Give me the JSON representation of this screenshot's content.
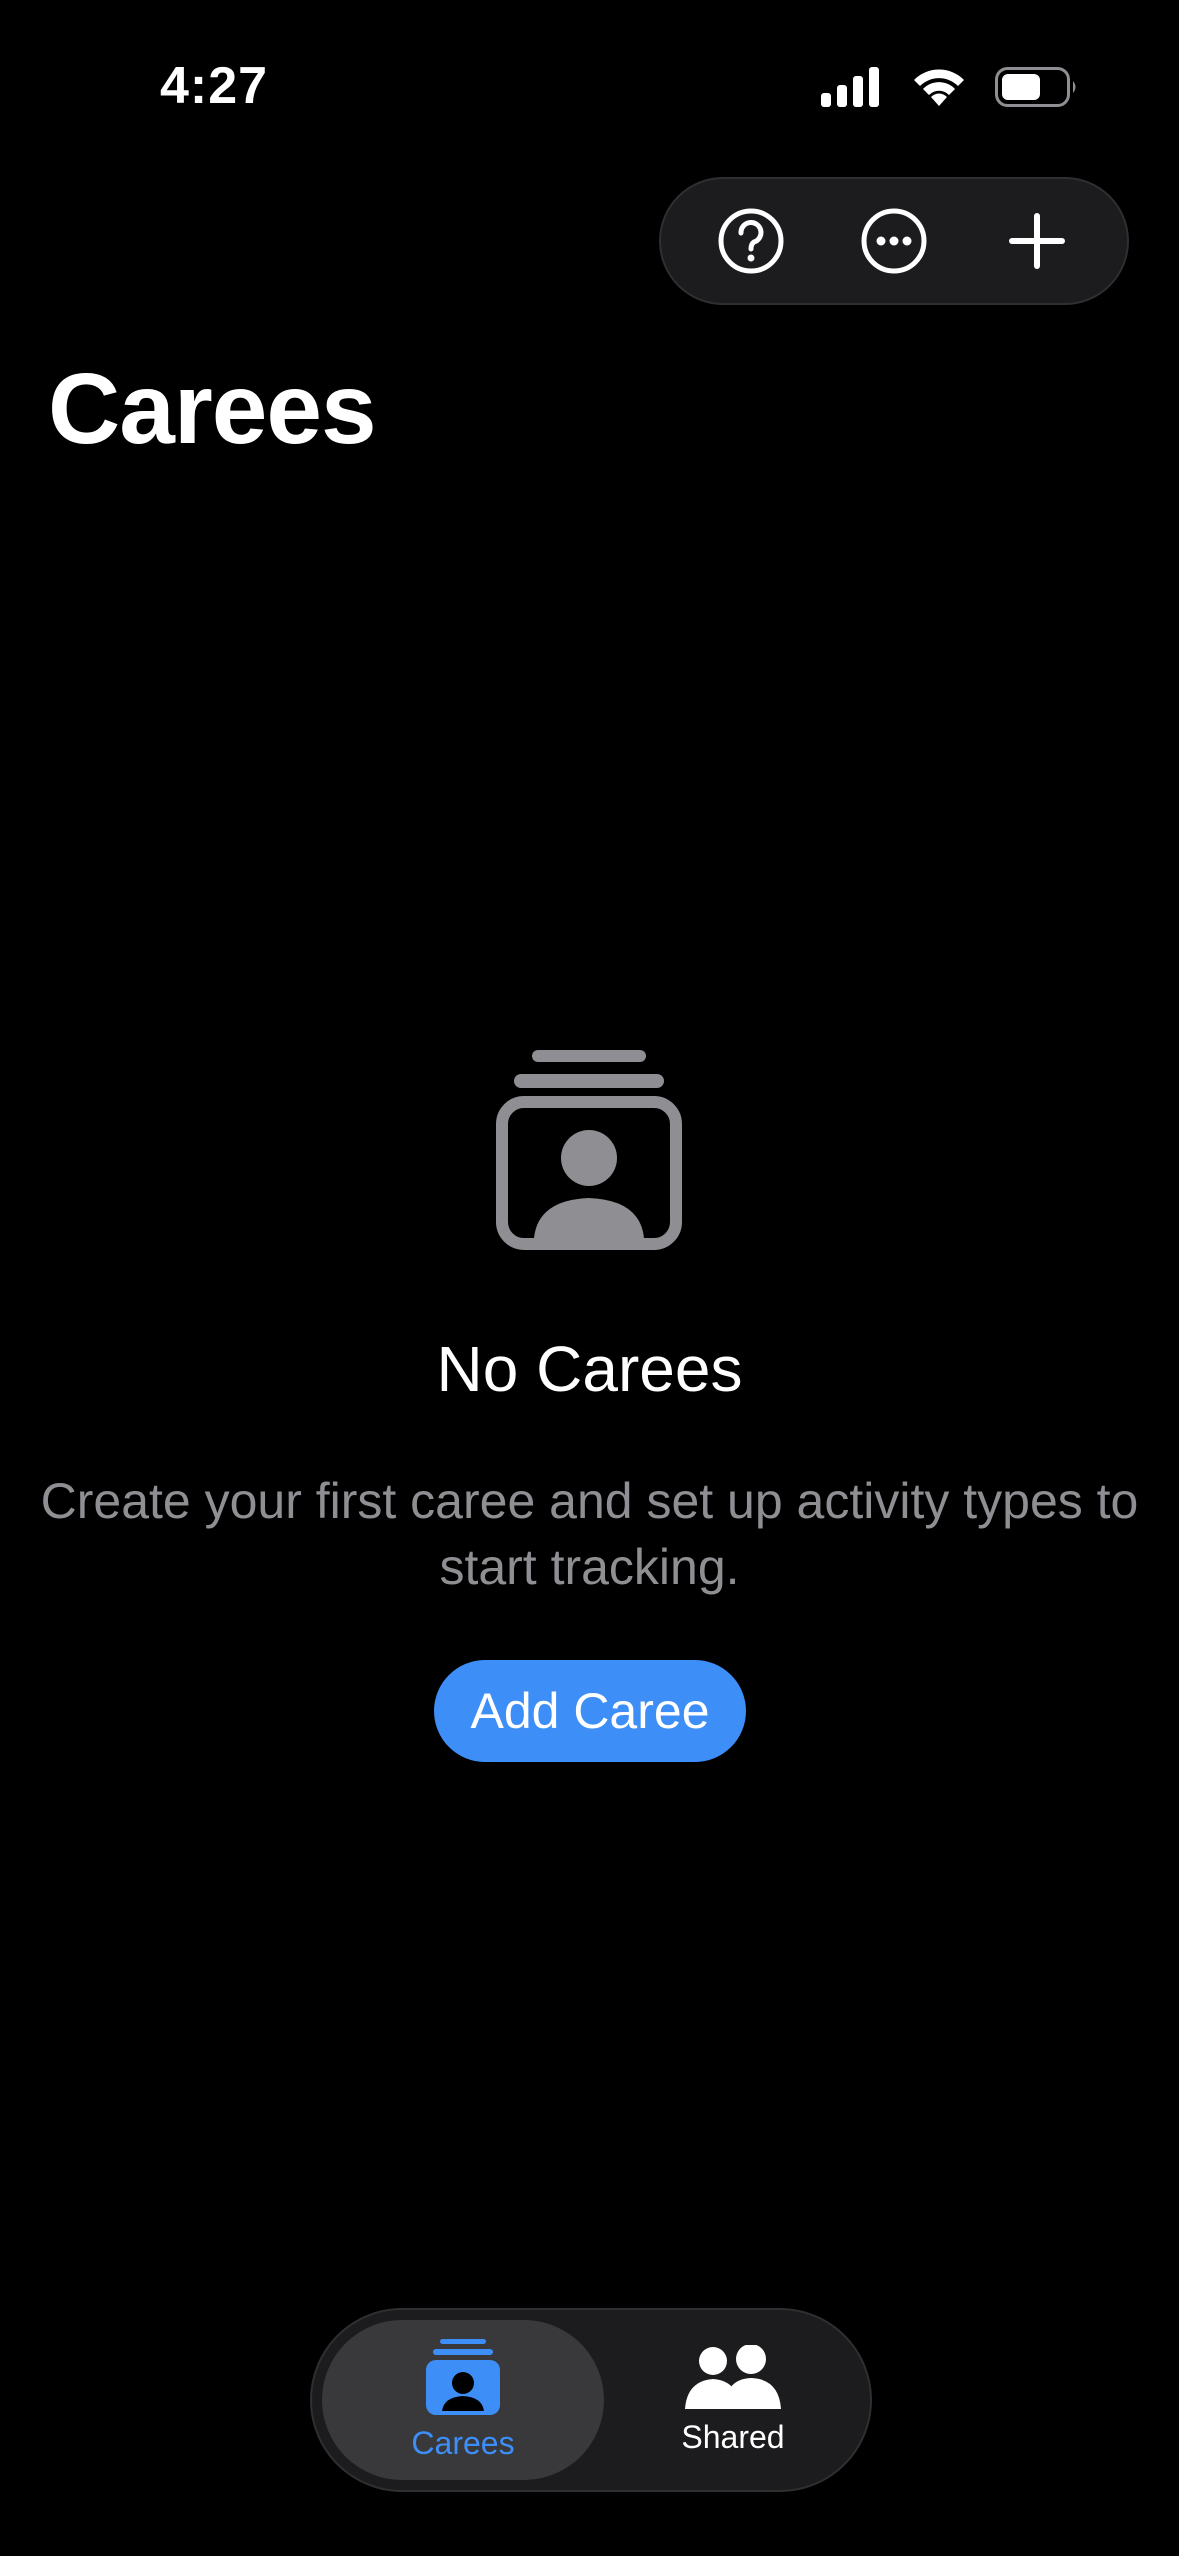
{
  "status_bar": {
    "time": "4:27",
    "icons": [
      "signal-icon",
      "wifi-icon",
      "battery-icon"
    ]
  },
  "toolbar": {
    "icons": [
      "help-icon",
      "more-icon",
      "add-icon"
    ]
  },
  "page": {
    "title": "Carees"
  },
  "empty_state": {
    "icon": "caree-stack-icon",
    "title": "No Carees",
    "message": "Create your first caree and set up activity types to start tracking.",
    "button_label": "Add Caree"
  },
  "tabbar": {
    "tabs": [
      {
        "label": "Carees",
        "icon": "caree-stack-icon",
        "selected": true
      },
      {
        "label": "Shared",
        "icon": "people-icon",
        "selected": false
      }
    ]
  },
  "colors": {
    "background": "#000000",
    "accent": "#3e8ef7",
    "secondary_text": "#8e8e93",
    "surface": "#1c1c1e"
  }
}
